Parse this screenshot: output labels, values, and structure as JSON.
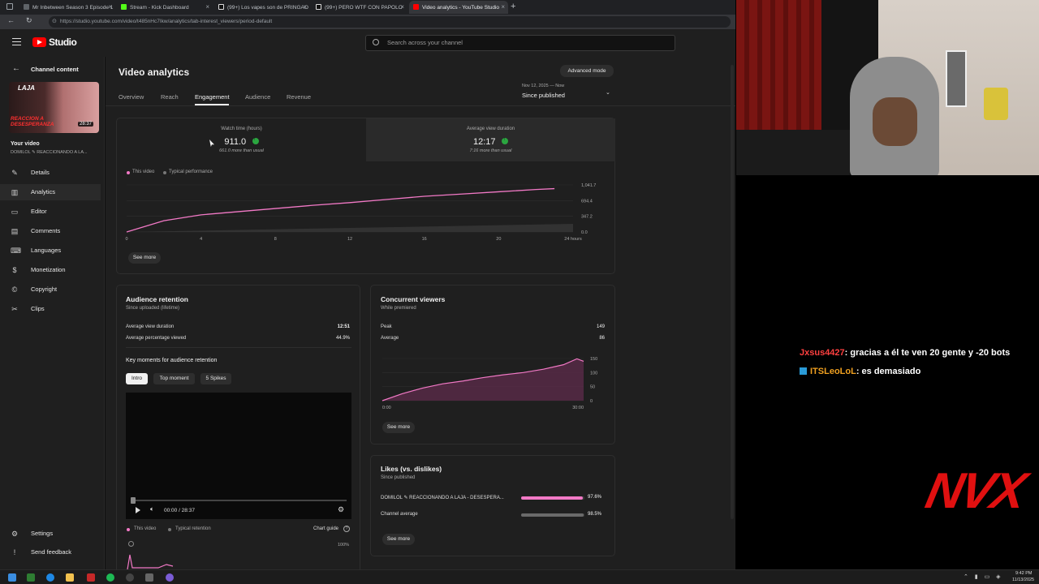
{
  "browser": {
    "tabs": [
      {
        "title": "Mr Inbetween Season 3 Episode 1",
        "color": "#5f6368"
      },
      {
        "title": "Stream - Kick Dashboard",
        "color": "#53fc18"
      },
      {
        "title": "(99+) Los vapes son de PRINGAO",
        "color": "#ffffff"
      },
      {
        "title": "(99+) PERO WTF CON PAPOLO",
        "color": "#ffffff"
      },
      {
        "title": "Video analytics - YouTube Studio",
        "color": "#ff0000"
      }
    ],
    "url": "https://studio.youtube.com/video/t485nHc7Ikw/analytics/tab-interest_viewers/period-default"
  },
  "header": {
    "logo_text": "Studio",
    "search_placeholder": "Search across your channel"
  },
  "sidebar": {
    "back_label": "Channel content",
    "thumb_duration": "28:37",
    "thumb_text_top": "LAJA",
    "thumb_text_bottom": "REACCION A DESESPERANZA",
    "your_video": "Your video",
    "video_title": "DOMILOL ✎ REACCIONANDO A LA...",
    "items": [
      {
        "label": "Details",
        "icon": "✎"
      },
      {
        "label": "Analytics",
        "icon": "▥"
      },
      {
        "label": "Editor",
        "icon": "▭"
      },
      {
        "label": "Comments",
        "icon": "▤"
      },
      {
        "label": "Languages",
        "icon": "⌨"
      },
      {
        "label": "Monetization",
        "icon": "$"
      },
      {
        "label": "Copyright",
        "icon": "©"
      },
      {
        "label": "Clips",
        "icon": "✂"
      }
    ],
    "settings": "Settings",
    "feedback": "Send feedback"
  },
  "main": {
    "title": "Video analytics",
    "advanced_mode": "Advanced mode",
    "tabs": [
      "Overview",
      "Reach",
      "Engagement",
      "Audience",
      "Revenue"
    ],
    "date_range_small": "Nov 12, 2025 — Now",
    "date_range": "Since published",
    "metrics": [
      {
        "label": "Watch time (hours)",
        "value": "911.0",
        "sub": "661.0 more than usual"
      },
      {
        "label": "Average view duration",
        "value": "12:17",
        "sub": "7:16 more than usual"
      }
    ],
    "legend_this": "This video",
    "legend_typical": "Typical performance",
    "see_more": "See more"
  },
  "chart_data": [
    {
      "type": "line",
      "title": "Watch time (hours)",
      "x_ticks": [
        "0",
        "4",
        "8",
        "12",
        "16",
        "20",
        "24 hours"
      ],
      "y_ticks": [
        "1,041.7",
        "694.4",
        "347.2",
        "0.0"
      ],
      "ylim": [
        0,
        1041.7
      ],
      "series": [
        {
          "name": "This video",
          "x": [
            0,
            2,
            4,
            6,
            8,
            10,
            12,
            14,
            16,
            18,
            20,
            22,
            23
          ],
          "y": [
            0,
            250,
            380,
            450,
            520,
            590,
            650,
            720,
            790,
            840,
            890,
            940,
            960
          ]
        },
        {
          "name": "Typical performance",
          "x": [
            0,
            24
          ],
          "y": [
            0,
            180
          ]
        }
      ]
    },
    {
      "type": "area",
      "title": "Concurrent viewers",
      "x_ticks": [
        "0:00",
        "30:00"
      ],
      "y_ticks": [
        "150",
        "100",
        "50",
        "0"
      ],
      "ylim": [
        0,
        150
      ],
      "series": [
        {
          "name": "This video",
          "x": [
            0,
            3,
            6,
            9,
            12,
            15,
            18,
            21,
            24,
            27,
            29,
            30
          ],
          "y": [
            0,
            25,
            45,
            60,
            70,
            82,
            92,
            100,
            112,
            128,
            149,
            140
          ]
        }
      ]
    }
  ],
  "retention": {
    "title": "Audience retention",
    "subtitle": "Since uploaded (lifetime)",
    "rows": [
      {
        "label": "Average view duration",
        "value": "12:51"
      },
      {
        "label": "Average percentage viewed",
        "value": "44.9%"
      }
    ],
    "key_moments": "Key moments for audience retention",
    "chips": [
      "Intro",
      "Top moment",
      "5 Spikes"
    ],
    "time": "00:00 / 28:37",
    "legend_this": "This video",
    "legend_typical": "Typical retention",
    "chart_guide": "Chart guide",
    "y_top": "100%"
  },
  "concurrent": {
    "title": "Concurrent viewers",
    "subtitle": "While premiered",
    "rows": [
      {
        "label": "Peak",
        "value": "149"
      },
      {
        "label": "Average",
        "value": "86"
      }
    ],
    "see_more": "See more"
  },
  "likes": {
    "title": "Likes (vs. dislikes)",
    "subtitle": "Since published",
    "rows": [
      {
        "label": "DOMILOL ✎ REACCIONANDO A LAJA - DESESPERA...",
        "value": "97.6%",
        "fraction": 0.976,
        "color": "#f279c6"
      },
      {
        "label": "Channel average",
        "value": "98.5%",
        "fraction": 0.985,
        "color": "#6a6a6a"
      }
    ],
    "see_more": "See more"
  },
  "stream": {
    "chat": [
      {
        "user": "Jxsus4427",
        "user_color": "#ff4040",
        "text": ": gracias a él te ven 20 gente y -20 bots"
      },
      {
        "user": "ITSLeoLoL",
        "user_color": "#f0a020",
        "text": ": es demasiado"
      }
    ],
    "logo": "NVX"
  },
  "taskbar": {
    "time": "9:42 PM",
    "date": "11/13/2025"
  }
}
